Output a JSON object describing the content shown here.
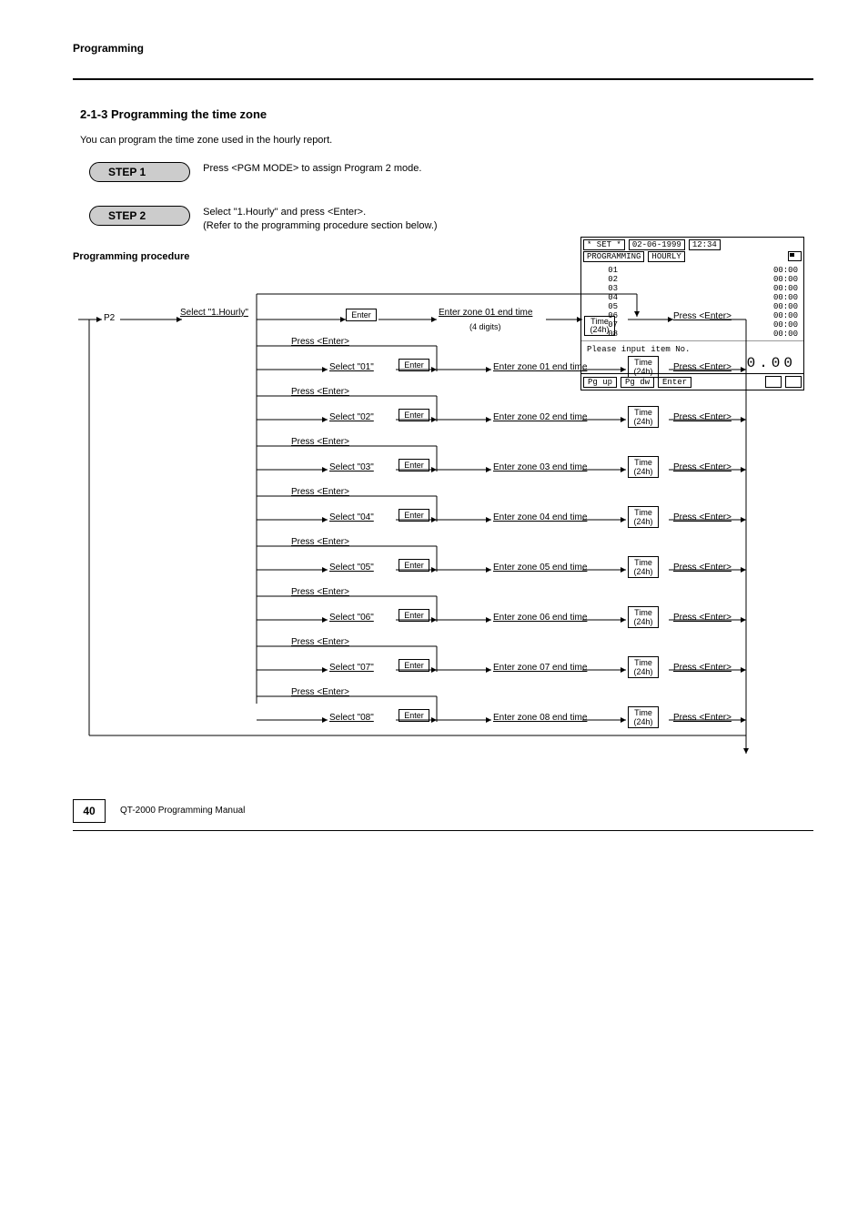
{
  "header": {
    "title": "Programming"
  },
  "section": {
    "heading": "2-1-3 Programming the time zone",
    "intro": "You can program the time zone used in the hourly report."
  },
  "steps": {
    "step1": {
      "label": "STEP 1",
      "desc": "Press <PGM MODE> to assign Program 2 mode."
    },
    "step2": {
      "label": "STEP 2",
      "desc": "Select \"1.Hourly\" and press <Enter>.\n(Refer to the programming procedure section below.)"
    }
  },
  "programming": {
    "subtitle": "Programming procedure"
  },
  "screenshot": {
    "mode": "* SET *",
    "date": "02-06-1999",
    "time": "12:34",
    "tab1": "PROGRAMMING",
    "tab2": "HOURLY",
    "rows": [
      {
        "n": "01",
        "t": "00:00"
      },
      {
        "n": "02",
        "t": "00:00"
      },
      {
        "n": "03",
        "t": "00:00"
      },
      {
        "n": "04",
        "t": "00:00"
      },
      {
        "n": "05",
        "t": "00:00"
      },
      {
        "n": "06",
        "t": "00:00"
      },
      {
        "n": "07",
        "t": "00:00"
      },
      {
        "n": "08",
        "t": "00:00"
      }
    ],
    "msg": "Please input item No.",
    "big": "0.00",
    "btnPgUp": "Pg up",
    "btnPgDw": "Pg dw",
    "btnEnter": "Enter"
  },
  "flow": {
    "p2": "P2",
    "selectHourly": "Select \"1.Hourly\"",
    "enterKey": "Enter",
    "enterZone01Digits": "Enter zone 01 end time",
    "fourDigits": "(4 digits)",
    "timeKey": "Time\n(24h)",
    "pressEnter": "Press <Enter>",
    "zones": [
      {
        "sel": "Select \"01\"",
        "enter": "Enter zone 01 end time"
      },
      {
        "sel": "Select \"02\"",
        "enter": "Enter zone 02 end time"
      },
      {
        "sel": "Select \"03\"",
        "enter": "Enter zone 03 end time"
      },
      {
        "sel": "Select \"04\"",
        "enter": "Enter zone 04 end time"
      },
      {
        "sel": "Select \"05\"",
        "enter": "Enter zone 05 end time"
      },
      {
        "sel": "Select \"06\"",
        "enter": "Enter zone 06 end time"
      },
      {
        "sel": "Select \"07\"",
        "enter": "Enter zone 07 end time"
      },
      {
        "sel": "Select \"08\"",
        "enter": "Enter zone 08 end time"
      }
    ]
  },
  "footer": {
    "page": "40",
    "ref": "QT-2000 Programming Manual"
  }
}
